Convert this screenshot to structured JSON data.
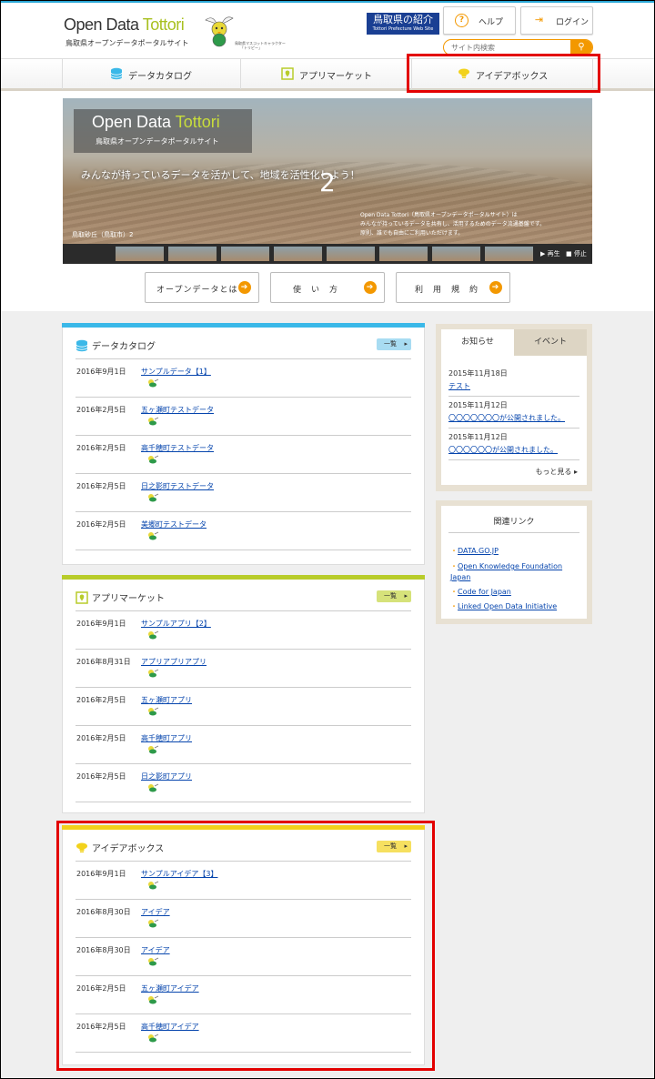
{
  "header": {
    "logo_main": "Open Data ",
    "logo_accent": "Tottori",
    "logo_sub": "鳥取県オープンデータポータルサイト",
    "mascot_caption_1": "鳥取県マスコットキャラクター",
    "mascot_caption_2": "「トリピー」",
    "pref_link_1": "鳥取県の紹介",
    "pref_link_2": "Tottori Prefecture Web Site",
    "help": "ヘルプ",
    "login": "ログイン",
    "search_placeholder": "サイト内検索"
  },
  "nav": [
    {
      "label": "データカタログ",
      "icon": "database-icon"
    },
    {
      "label": "アプリマーケット",
      "icon": "app-icon"
    },
    {
      "label": "アイデアボックス",
      "icon": "lightbulb-icon"
    }
  ],
  "hero": {
    "logo_main": "Open Data ",
    "logo_accent": "Tottori",
    "logo_sub": "鳥取県オープンデータポータルサイト",
    "catch": "みんなが持っているデータを活かして、地域を活性化しよう！",
    "slide_number": "2",
    "desc_1": "Open Data Tottori（鳥取県オープンデータポータルサイト）は",
    "desc_2": "みんなが持っているデータを共有し、活用するためのデータ流通基盤です。",
    "desc_3": "原則、誰でも自由にご利用いただけます。",
    "caption": "鳥取砂丘（鳥取市）2",
    "play": "▶ 再生",
    "stop": "■ 停止"
  },
  "buttons": {
    "about": "オープンデータとは",
    "howto": "使　い　方",
    "terms": "利　用　規　約"
  },
  "catalog": {
    "title": "データカタログ",
    "more": "一覧",
    "items": [
      {
        "date": "2016年9月1日",
        "title": "サンプルデータ【1】"
      },
      {
        "date": "2016年2月5日",
        "title": "五ヶ瀬町テストデータ"
      },
      {
        "date": "2016年2月5日",
        "title": "高千穂町テストデータ"
      },
      {
        "date": "2016年2月5日",
        "title": "日之影町テストデータ"
      },
      {
        "date": "2016年2月5日",
        "title": "美郷町テストデータ"
      }
    ]
  },
  "apps": {
    "title": "アプリマーケット",
    "more": "一覧",
    "items": [
      {
        "date": "2016年9月1日",
        "title": "サンプルアプリ【2】"
      },
      {
        "date": "2016年8月31日",
        "title": "アプリアプリアプリ"
      },
      {
        "date": "2016年2月5日",
        "title": "五ヶ瀬町アプリ"
      },
      {
        "date": "2016年2月5日",
        "title": "高千穂町アプリ"
      },
      {
        "date": "2016年2月5日",
        "title": "日之影町アプリ"
      }
    ]
  },
  "ideas": {
    "title": "アイデアボックス",
    "more": "一覧",
    "items": [
      {
        "date": "2016年9月1日",
        "title": "サンプルアイデア【3】"
      },
      {
        "date": "2016年8月30日",
        "title": "アイデア"
      },
      {
        "date": "2016年8月30日",
        "title": "アイデア"
      },
      {
        "date": "2016年2月5日",
        "title": "五ヶ瀬町アイデア"
      },
      {
        "date": "2016年2月5日",
        "title": "高千穂町アイデア"
      }
    ]
  },
  "news": {
    "tab_news": "お知らせ",
    "tab_event": "イベント",
    "items": [
      {
        "date": "2015年11月18日",
        "title": "テスト"
      },
      {
        "date": "2015年11月12日",
        "title": "〇〇〇〇〇〇〇が公開されました。"
      },
      {
        "date": "2015年11月12日",
        "title": "〇〇〇〇〇〇が公開されました。"
      }
    ],
    "more": "もっと見る"
  },
  "links": {
    "title": "関連リンク",
    "items": [
      "DATA.GO.JP",
      "Open Knowledge Foundation Japan",
      "Code for Japan",
      "Linked Open Data Initiative"
    ]
  },
  "colors": {
    "catalog": "#3ab8e8",
    "apps": "#b8cc2a",
    "ideas": "#f2d21c",
    "accent": "#f39800",
    "highlight": "#e30000"
  }
}
